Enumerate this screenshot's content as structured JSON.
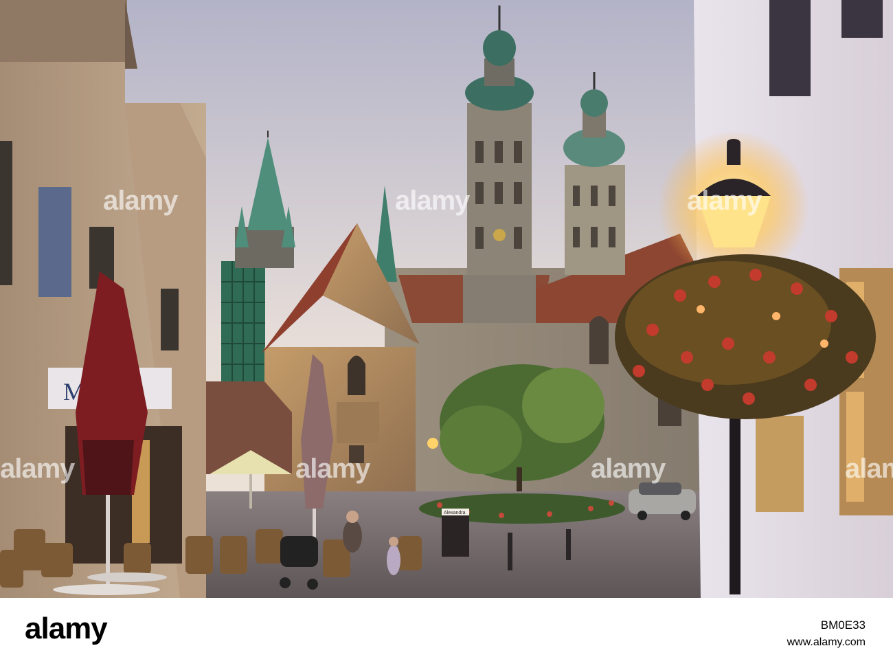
{
  "scene": {
    "sign_text": "M    Dom",
    "board_title": "Alexandra"
  },
  "watermark": {
    "text": "alamy"
  },
  "footer": {
    "logo": "alamy",
    "image_id": "BM0E33",
    "website": "www.alamy.com"
  },
  "colors": {
    "sky_top": "#b7b6c9",
    "sky_bottom": "#efe6dc",
    "roof_red": "#8c3a2a",
    "copper_green": "#3e7a6a",
    "lamp_glow": "#ffd36a",
    "footer_bg": "#ffffff"
  }
}
